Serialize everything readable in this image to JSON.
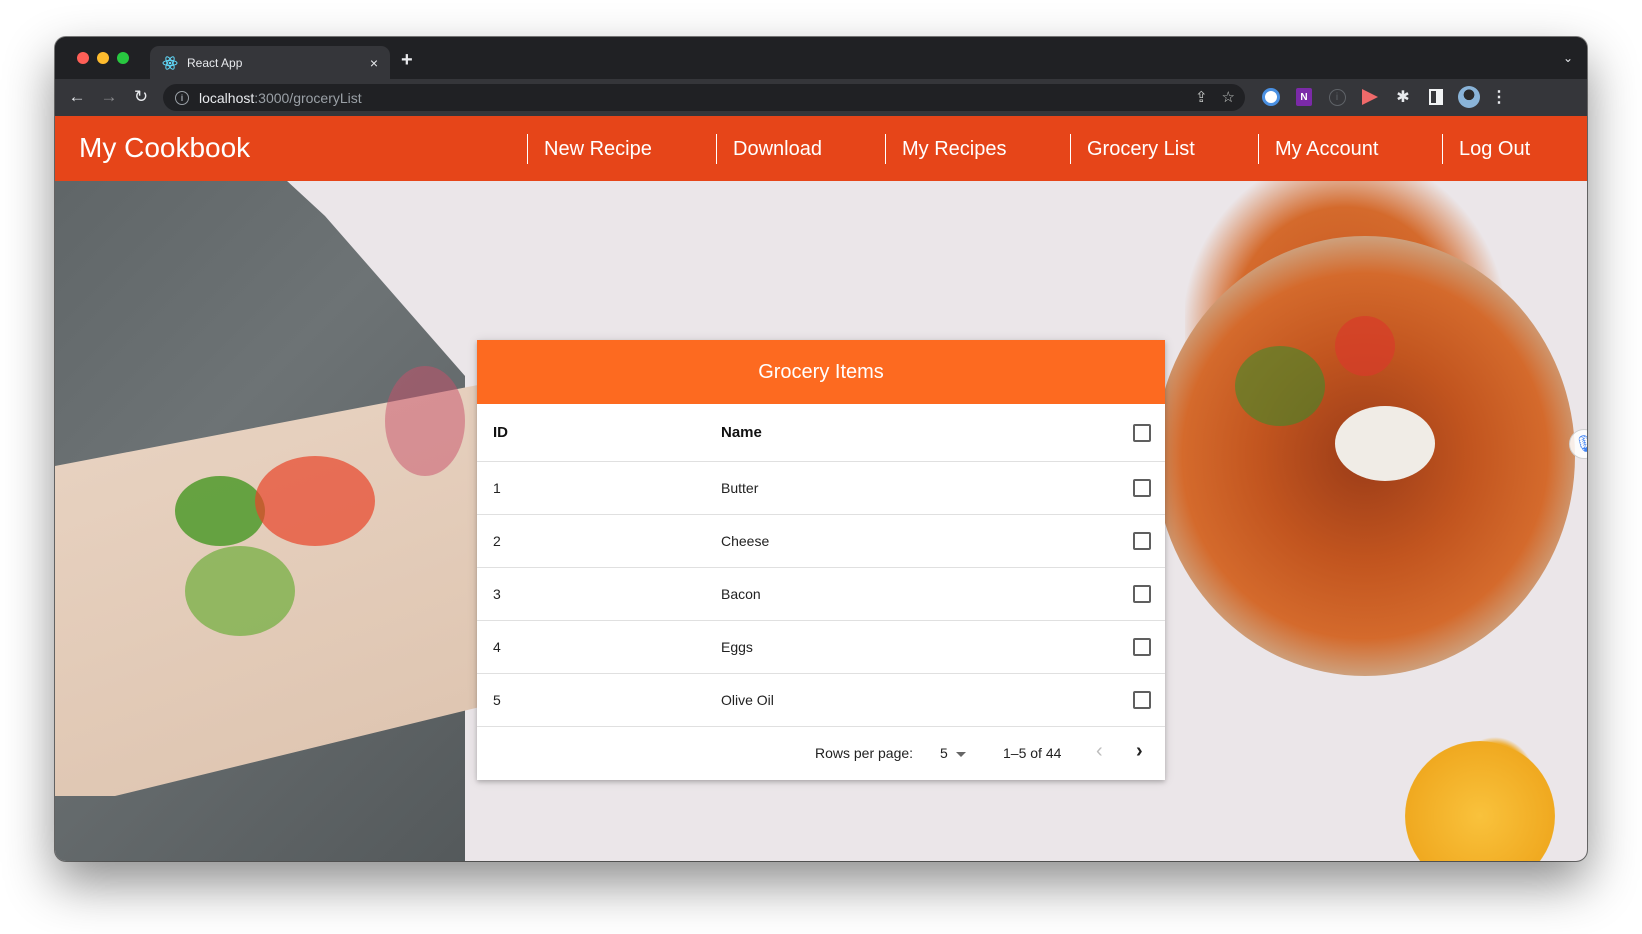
{
  "browser": {
    "tab_title": "React App",
    "tab_close": "×",
    "new_tab": "+",
    "tab_dropdown": "⌄",
    "url_host": "localhost",
    "url_path": ":3000/groceryList",
    "back": "←",
    "forward": "→",
    "reload": "↻",
    "share": "⇪",
    "bookmark": "☆",
    "ext_onenote": "N",
    "ext_info": "i",
    "ext_puzzle": "✱",
    "kebab": "⋮"
  },
  "app": {
    "brand": "My Cookbook",
    "nav": [
      {
        "label": "New Recipe"
      },
      {
        "label": "Download"
      },
      {
        "label": "My Recipes"
      },
      {
        "label": "Grocery List"
      },
      {
        "label": "My Account"
      },
      {
        "label": "Log Out"
      }
    ],
    "accent_color": "#e64519",
    "card_header_color": "#fd6a20"
  },
  "grocery": {
    "title": "Grocery Items",
    "columns": {
      "id": "ID",
      "name": "Name"
    },
    "rows": [
      {
        "id": "1",
        "name": "Butter",
        "checked": false
      },
      {
        "id": "2",
        "name": "Cheese",
        "checked": false
      },
      {
        "id": "3",
        "name": "Bacon",
        "checked": false
      },
      {
        "id": "4",
        "name": "Eggs",
        "checked": false
      },
      {
        "id": "5",
        "name": "Olive Oil",
        "checked": false
      }
    ],
    "pagination": {
      "rows_per_page_label": "Rows per page:",
      "rows_per_page": "5",
      "range": "1–5 of 44",
      "prev": "‹",
      "next": "›"
    }
  },
  "mic_icon": "🎙"
}
